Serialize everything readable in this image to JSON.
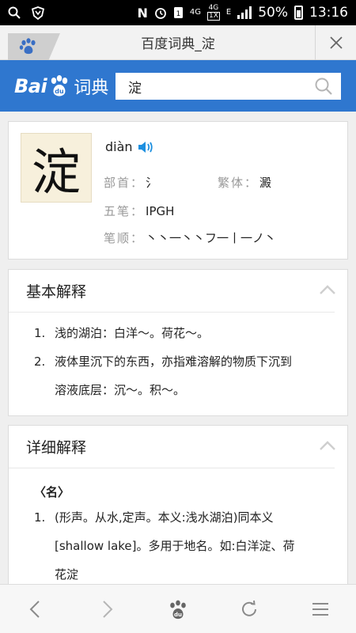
{
  "status_bar": {
    "network_type": "4G",
    "battery_percent": "50%",
    "time": "13:16",
    "lte_label": "4G",
    "lte_sub": "1X",
    "edge_label": "E"
  },
  "title_bar": {
    "title": "百度词典_淀"
  },
  "header": {
    "logo_bai": "Bai",
    "logo_cidian": "词典",
    "search_value": "淀"
  },
  "character": {
    "glyph": "淀",
    "pinyin": "diàn",
    "radical_label": "部首：",
    "radical_value": "氵",
    "traditional_label": "繁体：",
    "traditional_value": "澱",
    "wubi_label": "五笔：",
    "wubi_value": "IPGH",
    "strokes_label": "笔顺：",
    "strokes_value": "丶丶一丶丶フ一丨一ノ丶"
  },
  "basic": {
    "heading": "基本解释",
    "items": [
      {
        "num": "1.",
        "text": "浅的湖泊：白洋～。荷花～。"
      },
      {
        "num": "2.",
        "text": "液体里沉下的东西，亦指难溶解的物质下沉到"
      },
      {
        "num": "",
        "text": "溶液底层：沉～。积～。"
      }
    ]
  },
  "detail": {
    "heading": "详细解释",
    "pos": "〈名〉",
    "items": [
      {
        "num": "1.",
        "text": "(形声。从水,定声。本义:浅水湖泊)同本义"
      },
      {
        "num": "",
        "text": "[shallow lake]。多用于地名。如:白洋淀、荷"
      },
      {
        "num": "",
        "text": "花淀"
      }
    ]
  },
  "colors": {
    "header_blue": "#2f77cf",
    "speaker_blue": "#1e90e0"
  }
}
